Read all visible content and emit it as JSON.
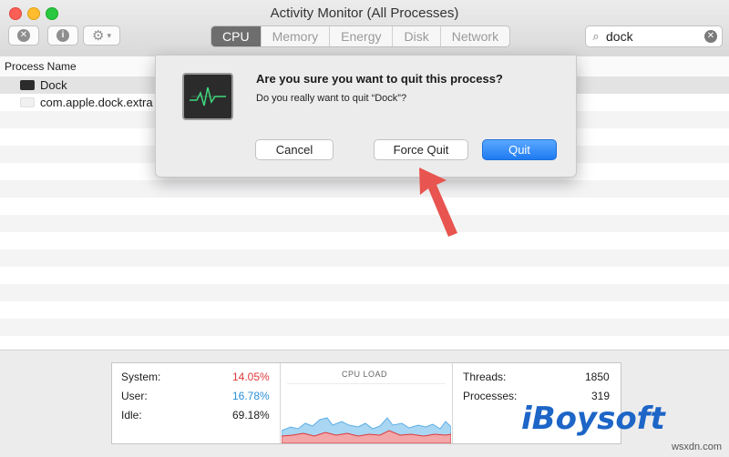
{
  "window": {
    "title": "Activity Monitor (All Processes)"
  },
  "toolbar": {
    "buttons": [
      {
        "name": "stop-process",
        "icon": "close-icon"
      },
      {
        "name": "inspect-process",
        "icon": "info-icon"
      },
      {
        "name": "settings-menu",
        "icon": "gear-icon"
      }
    ],
    "tabs": [
      {
        "label": "CPU",
        "active": true
      },
      {
        "label": "Memory"
      },
      {
        "label": "Energy"
      },
      {
        "label": "Disk"
      },
      {
        "label": "Network"
      }
    ],
    "search": {
      "value": "dock",
      "icon": "search-icon"
    }
  },
  "table": {
    "column_header": "Process Name",
    "rows": [
      {
        "label": "Dock",
        "selected": true
      },
      {
        "label": "com.apple.dock.extra"
      }
    ]
  },
  "dialog": {
    "title": "Are you sure you want to quit this process?",
    "message": "Do you really want to quit “Dock”?",
    "cancel_label": "Cancel",
    "force_quit_label": "Force Quit",
    "quit_label": "Quit"
  },
  "stats": {
    "system_label": "System:",
    "system_value": "14.05%",
    "user_label": "User:",
    "user_value": "16.78%",
    "idle_label": "Idle:",
    "idle_value": "69.18%",
    "cpu_load_title": "CPU LOAD",
    "threads_label": "Threads:",
    "threads_value": "1850",
    "processes_label": "Processes:",
    "processes_value": "319"
  },
  "overlay": {
    "brand": "iBoysoft",
    "watermark": "wsxdn.com"
  },
  "colors": {
    "system": "#e0383b",
    "user": "#2a8fd9",
    "accent": "#1f7bf2",
    "annotation_arrow": "#e8544f"
  }
}
